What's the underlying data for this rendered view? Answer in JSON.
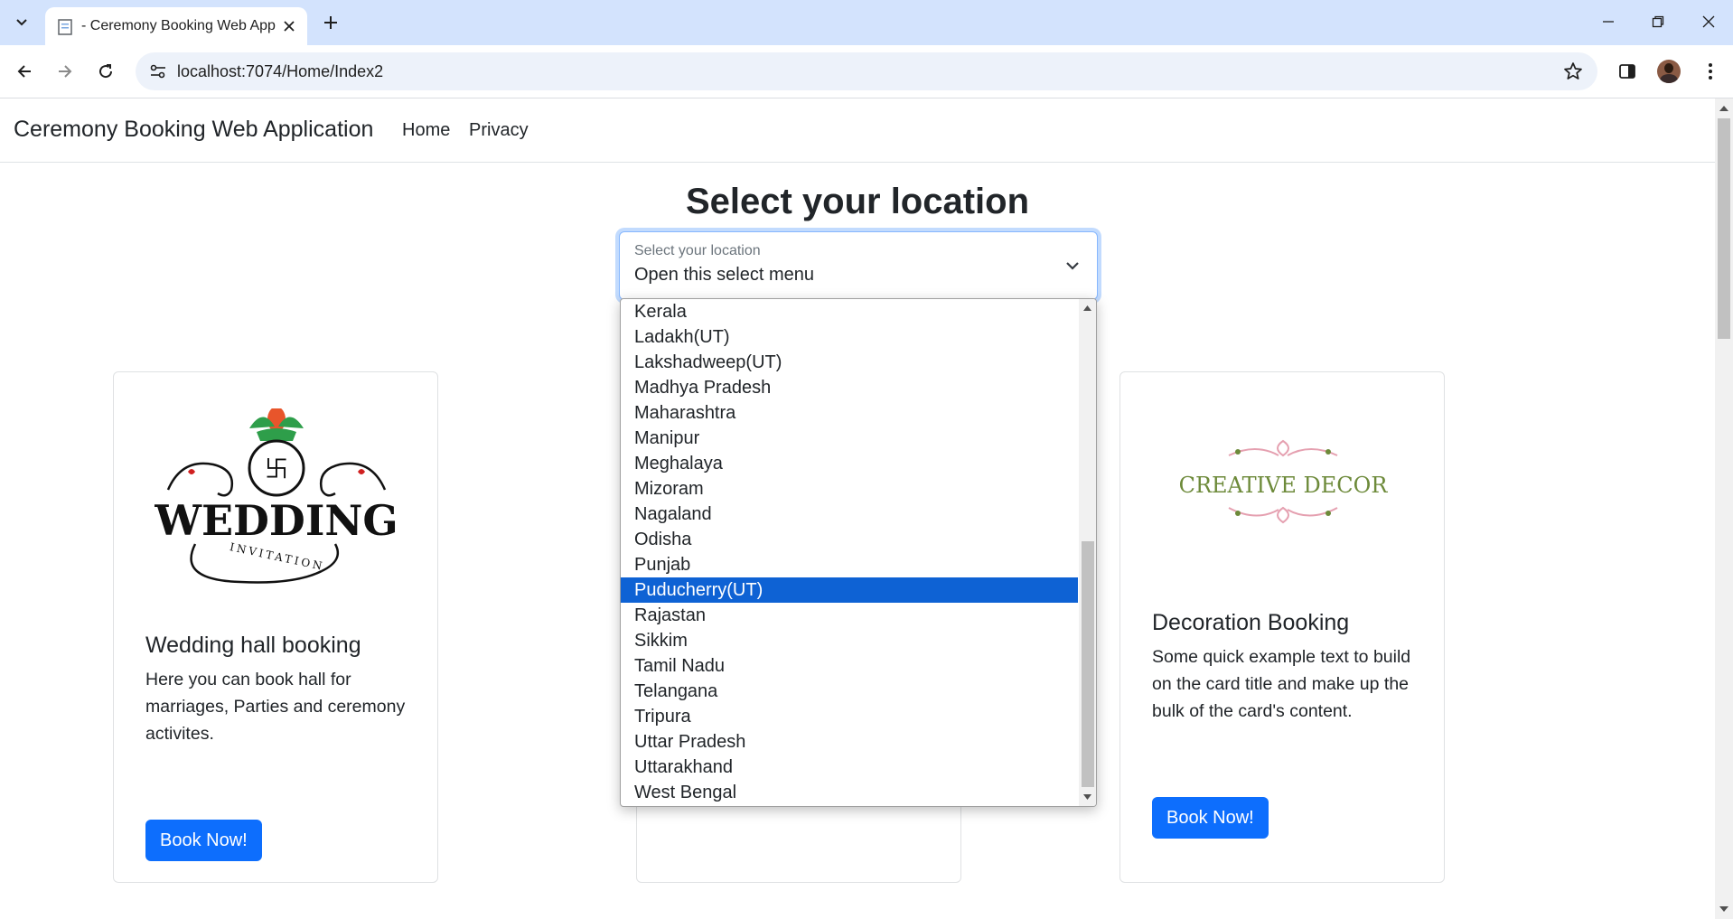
{
  "browser": {
    "tab_title": "- Ceremony Booking Web Appli",
    "url": "localhost:7074/Home/Index2"
  },
  "navbar": {
    "brand": "Ceremony Booking Web Application",
    "links": [
      "Home",
      "Privacy"
    ]
  },
  "main": {
    "heading": "Select your location",
    "select": {
      "label": "Select your location",
      "value": "Open this select menu",
      "options": [
        "Kerala",
        "Ladakh(UT)",
        "Lakshadweep(UT)",
        "Madhya Pradesh",
        "Maharashtra",
        "Manipur",
        "Meghalaya",
        "Mizoram",
        "Nagaland",
        "Odisha",
        "Punjab",
        "Puducherry(UT)",
        "Rajastan",
        "Sikkim",
        "Tamil Nadu",
        "Telangana",
        "Tripura",
        "Uttar Pradesh",
        "Uttarakhand",
        "West Bengal"
      ],
      "highlighted": "Puducherry(UT)"
    },
    "cards": [
      {
        "image_text": "WEDDING",
        "image_subtext": "INVITATION",
        "title": "Wedding hall booking",
        "text": "Here you can book hall for marriages, Parties and ceremony activites.",
        "button": "Book Now!"
      },
      {
        "image_text": "CREATIVE DECOR",
        "title": "Decoration Booking",
        "text": "Some quick example text to build on the card title and make up the bulk of the card's content.",
        "button": "Book Now!"
      }
    ]
  },
  "colors": {
    "primary": "#0d6efd",
    "selected_option": "#0e62d4",
    "tabbar": "#d3e3fd",
    "decor_green": "#6d8a3a",
    "decor_pink": "#e5a0b0"
  }
}
